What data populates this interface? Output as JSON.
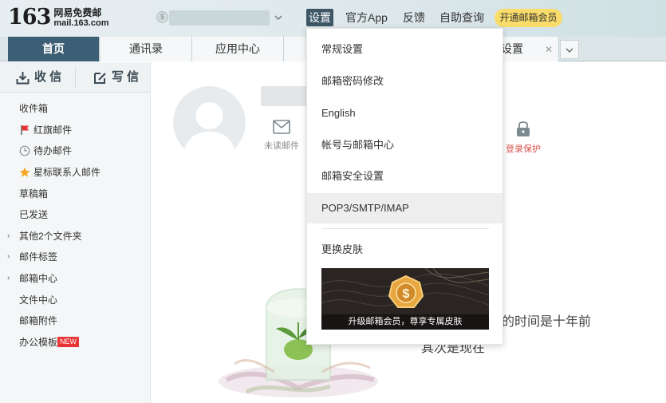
{
  "brand": {
    "number": "163",
    "name": "网易免费邮",
    "url": "mail.163.com"
  },
  "topnav": {
    "items": [
      {
        "label": "设置",
        "active": true
      },
      {
        "label": "官方App"
      },
      {
        "label": "反馈"
      },
      {
        "label": "自助查询"
      }
    ],
    "vip_label": "开通邮箱会员"
  },
  "tabs": [
    {
      "label": "首页"
    },
    {
      "label": "通讯录"
    },
    {
      "label": "应用中心"
    },
    {
      "label": "设置"
    }
  ],
  "sidebar": {
    "receive_label": "收 信",
    "compose_label": "写 信",
    "folders": [
      {
        "label": "收件箱"
      },
      {
        "label": "红旗邮件",
        "icon": "red-flag-icon"
      },
      {
        "label": "待办邮件",
        "icon": "clock-icon"
      },
      {
        "label": "星标联系人邮件",
        "icon": "star-icon"
      },
      {
        "label": "草稿箱"
      },
      {
        "label": "已发送"
      },
      {
        "label": "其他2个文件夹",
        "expandable": true
      },
      {
        "label": "邮件标签",
        "expandable": true
      },
      {
        "label": "邮箱中心",
        "expandable": true
      },
      {
        "label": "文件中心"
      },
      {
        "label": "邮箱附件"
      },
      {
        "label": "办公模板",
        "badge": "NEW"
      }
    ]
  },
  "main": {
    "unread_label": "未读邮件",
    "login_protect_label": "登录保护",
    "quote_line1": "的时间是十年前",
    "quote_line2": "其次是现在"
  },
  "settings_menu": {
    "items": [
      {
        "label": "常规设置"
      },
      {
        "label": "邮箱密码修改"
      },
      {
        "label": "English"
      },
      {
        "label": "帐号与邮箱中心"
      },
      {
        "label": "邮箱安全设置"
      },
      {
        "label": "POP3/SMTP/IMAP",
        "highlighted": true
      }
    ],
    "skin_label": "更换皮肤",
    "banner_caption": "升级邮箱会员，尊享专属皮肤"
  },
  "colors": {
    "accent_dark": "#3d5f75",
    "vip_yellow": "#f9dc6a",
    "flag_red": "#e83434",
    "star_orange": "#f5a623",
    "login_protect": "#d9534f"
  }
}
